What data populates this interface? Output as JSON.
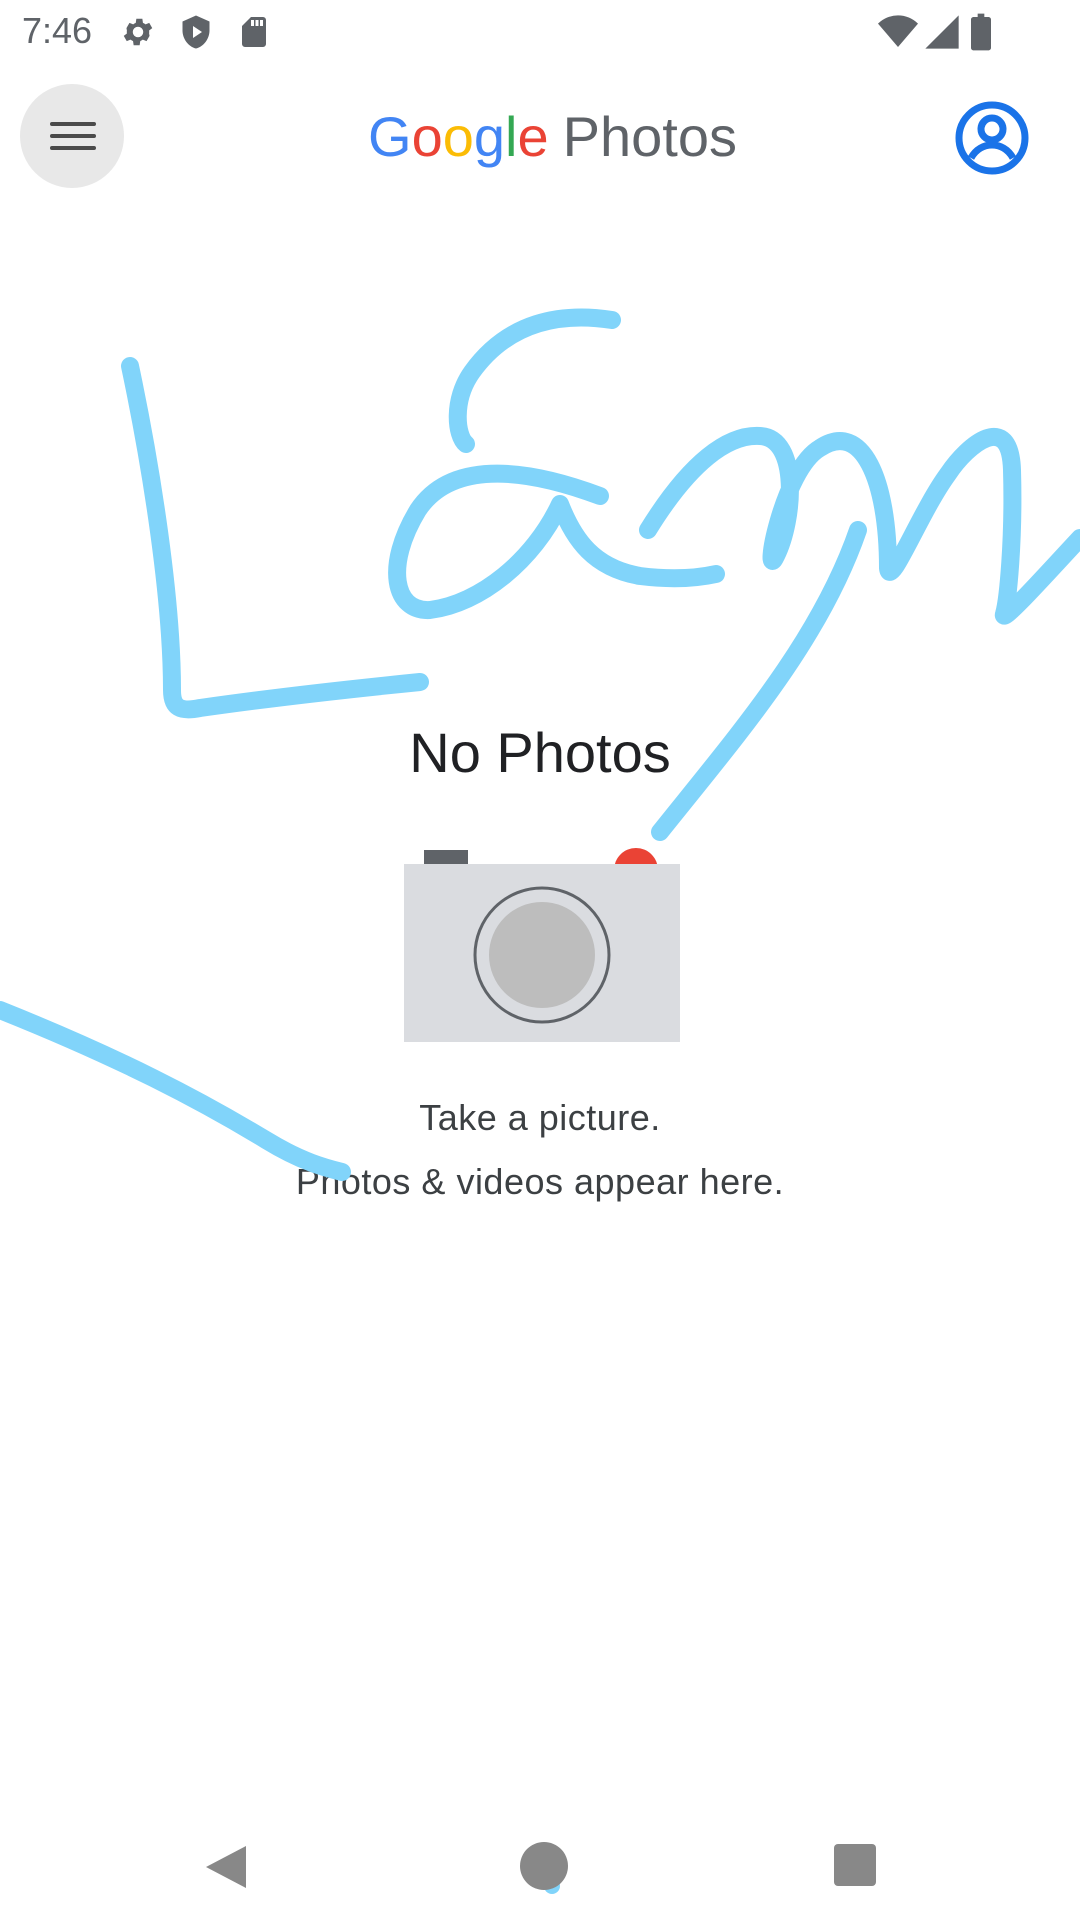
{
  "status_bar": {
    "time": "7:46",
    "icons_left": [
      "settings-icon",
      "shield-icon",
      "sd-card-icon"
    ],
    "icons_right": [
      "wifi-icon",
      "cell-signal-icon",
      "battery-icon"
    ]
  },
  "app_bar": {
    "menu_icon": "hamburger-menu-icon",
    "logo_letters": [
      "G",
      "o",
      "o",
      "g",
      "l",
      "e"
    ],
    "logo_product": "Photos",
    "account_icon": "account-circle-icon"
  },
  "empty_state": {
    "title": "No Photos",
    "illustration": "camera-icon",
    "line1": "Take a picture.",
    "line2": "Photos & videos appear here."
  },
  "nav_bar": {
    "icons": [
      "back-icon",
      "home-icon",
      "recents-icon"
    ]
  },
  "colors": {
    "google_blue": "#4285F4",
    "google_red": "#EA4335",
    "google_yellow": "#FBBC05",
    "google_green": "#34A853",
    "account_blue": "#1a73e8",
    "scribble": "#81D4FA"
  }
}
